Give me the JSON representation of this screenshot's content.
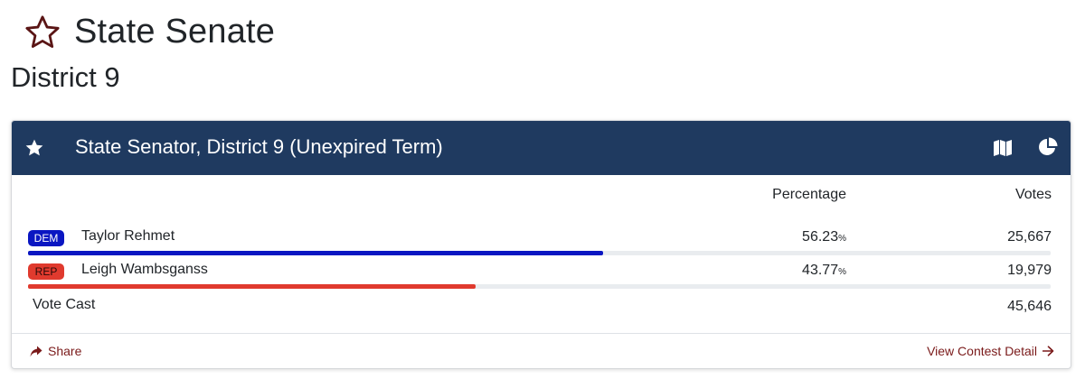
{
  "page": {
    "title": "State Senate",
    "subtitle": "District 9"
  },
  "contest": {
    "title": "State Senator, District 9 (Unexpired Term)",
    "columns": {
      "percentage": "Percentage",
      "votes": "Votes"
    },
    "candidates": [
      {
        "party": "DEM",
        "name": "Taylor Rehmet",
        "percent": "56.23",
        "percent_unit": "%",
        "share": 56.23,
        "votes": "25,667",
        "color": "#0a16c2"
      },
      {
        "party": "REP",
        "name": "Leigh Wambsganss",
        "percent": "43.77",
        "percent_unit": "%",
        "share": 43.77,
        "votes": "19,979",
        "color": "#e03a2e"
      }
    ],
    "total": {
      "label": "Vote Cast",
      "votes": "45,646"
    }
  },
  "footer": {
    "share_label": "Share",
    "detail_label": "View Contest Detail"
  },
  "icons": {
    "page_star": "star-outline-icon",
    "card_star": "star-icon",
    "map": "map-icon",
    "chart": "pie-chart-icon",
    "share": "share-icon",
    "arrow": "arrow-right-icon"
  },
  "colors": {
    "header_bg": "#1f3a60",
    "accent": "#7a1a1a",
    "dem": "#0a16c2",
    "rep": "#e03a2e"
  }
}
